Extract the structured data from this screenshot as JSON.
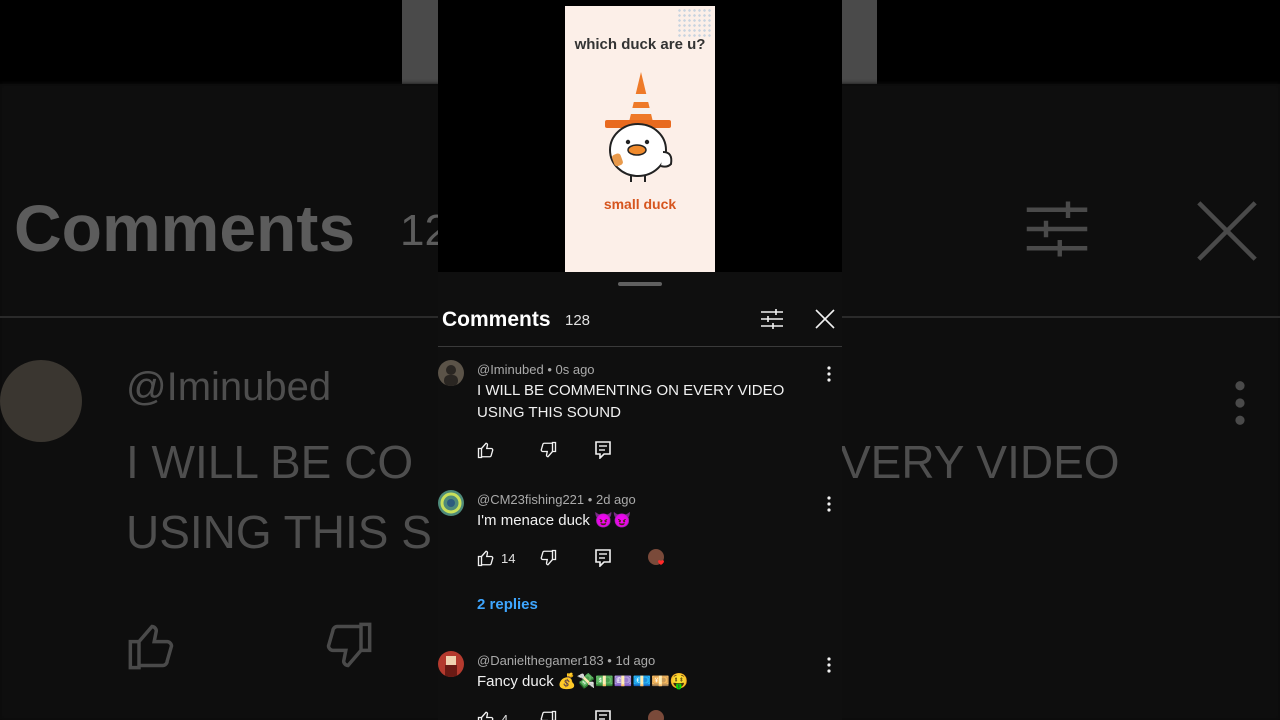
{
  "video": {
    "question": "which duck are u?",
    "caption": "small duck"
  },
  "comments_panel": {
    "title": "Comments",
    "count": "128",
    "filter_icon": "sliders-icon",
    "close_icon": "close-icon"
  },
  "comments": [
    {
      "handle": "@Iminubed",
      "time": "0s ago",
      "text": "I WILL BE COMMENTING ON EVERY VIDEO USING THIS SOUND",
      "likes": "",
      "avatar_color": "#5b5348"
    },
    {
      "handle": "@CM23fishing221",
      "time": "2d ago",
      "text": "I'm menace duck 😈😈",
      "likes": "14",
      "replies": "2 replies",
      "avatar_color": "#4e8a7a"
    },
    {
      "handle": "@Danielthegamer183",
      "time": "1d ago",
      "text": "Fancy duck 💰💸💵💷💶💴🤑",
      "likes": "4",
      "avatar_color": "#b43a2e"
    }
  ],
  "meta_separator": "•",
  "accent_color": "#3ea6ff"
}
